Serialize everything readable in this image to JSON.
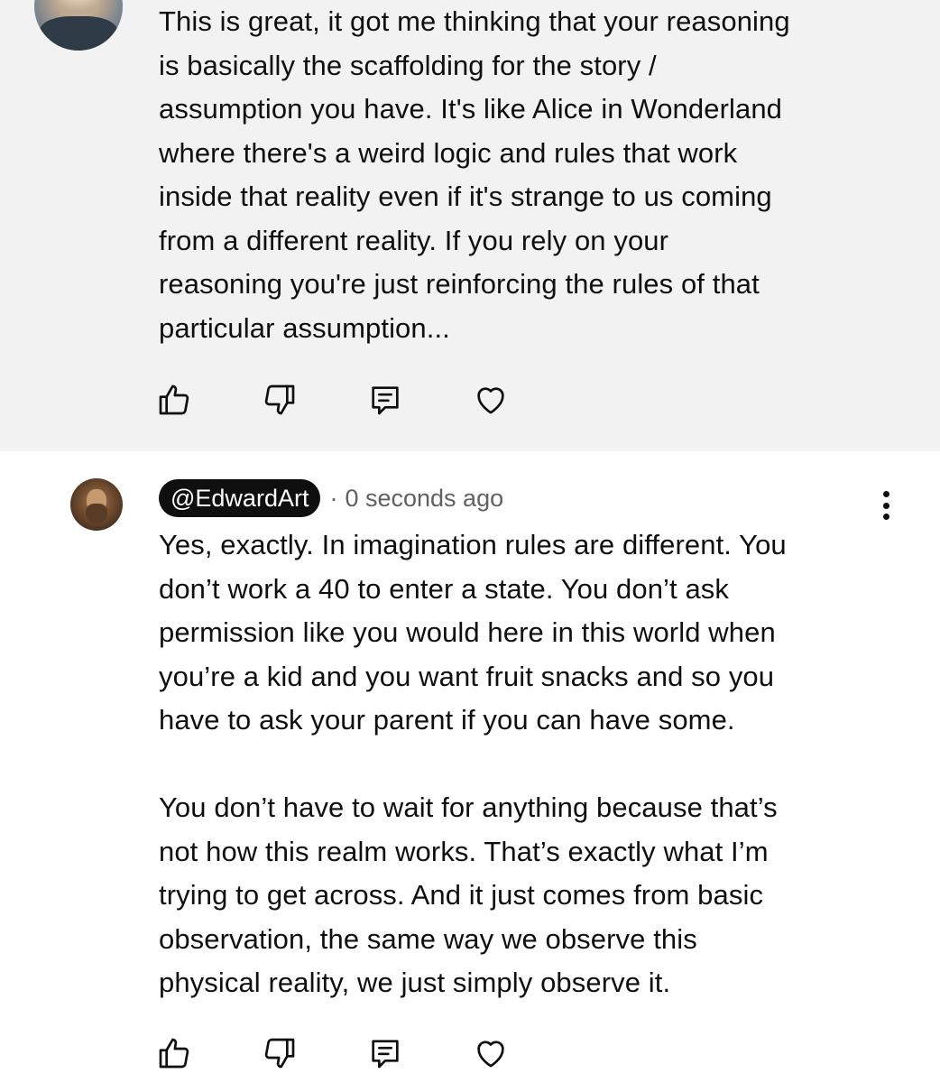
{
  "comments": [
    {
      "avatar_icon": "user-avatar",
      "text": "This is great, it got me thinking that your reasoning\nis basically the scaffolding for the story /\nassumption you have. It's like Alice in Wonderland\nwhere there's a weird logic and rules that work\ninside that reality even if it's strange to us coming\nfrom a different reality. If you rely on your\nreasoning you're just reinforcing the rules of that\nparticular assumption...",
      "actions": [
        "like-icon",
        "dislike-icon",
        "reply-icon",
        "heart-icon"
      ],
      "background": "#f2f2f2"
    },
    {
      "avatar_icon": "user-avatar",
      "author": "@EdwardArt",
      "separator": "·",
      "timestamp": "0 seconds ago",
      "text": "Yes, exactly. In imagination rules are different. You\ndon’t work a 40 to enter a state. You don’t ask\npermission like you would here in this world when\nyou’re a kid and you want fruit snacks and so you\nhave to ask your parent if you can have some.\n\nYou don’t have to wait for anything because that’s\nnot how this realm works. That’s exactly what I’m\ntrying to get across. And it just comes from basic\nobservation, the same way we observe this\nphysical reality, we just simply observe it.",
      "actions": [
        "like-icon",
        "dislike-icon",
        "reply-icon",
        "heart-icon"
      ],
      "more_icon": "more-vertical-icon",
      "background": "#ffffff"
    }
  ]
}
